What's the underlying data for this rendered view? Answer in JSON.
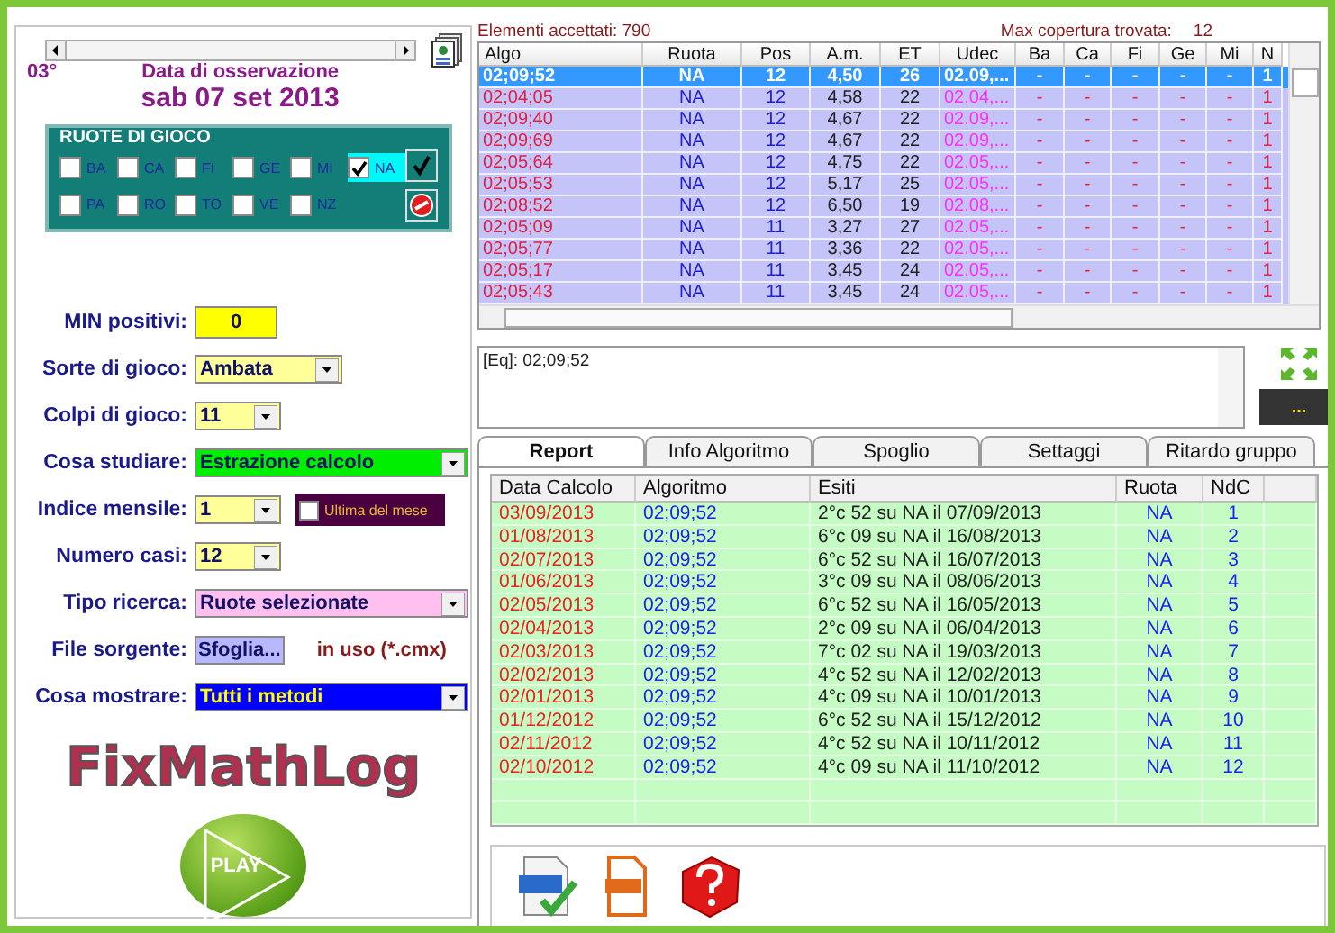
{
  "left": {
    "position": "03°",
    "date_caption": "Data di osservazione",
    "date": "sab 07 set 2013",
    "ruote": {
      "title": "RUOTE DI GIOCO",
      "items": [
        {
          "label": "BA",
          "checked": false
        },
        {
          "label": "CA",
          "checked": false
        },
        {
          "label": "FI",
          "checked": false
        },
        {
          "label": "GE",
          "checked": false
        },
        {
          "label": "MI",
          "checked": false
        },
        {
          "label": "NA",
          "checked": true
        },
        {
          "label": "PA",
          "checked": false
        },
        {
          "label": "RO",
          "checked": false
        },
        {
          "label": "TO",
          "checked": false
        },
        {
          "label": "VE",
          "checked": false
        },
        {
          "label": "NZ",
          "checked": false
        }
      ]
    },
    "fields": [
      {
        "label": "MIN positivi:",
        "kind": "number",
        "value": "0",
        "color": "#ffff00"
      },
      {
        "label": "Sorte di gioco:",
        "kind": "select",
        "value": "Ambata",
        "color": "#ffff99"
      },
      {
        "label": "Colpi di gioco:",
        "kind": "select",
        "value": "11",
        "color": "#ffff99"
      },
      {
        "label": "Cosa studiare:",
        "kind": "select",
        "value": "Estrazione calcolo",
        "color": "#00ee00"
      },
      {
        "label": "Indice mensile:",
        "kind": "select",
        "value": "1",
        "color": "#ffff99",
        "extra": {
          "label": "Ultima del mese",
          "checked": false
        }
      },
      {
        "label": "Numero casi:",
        "kind": "select",
        "value": "12",
        "color": "#ffff99"
      },
      {
        "label": "Tipo ricerca:",
        "kind": "select",
        "value": "Ruote selezionate",
        "color": "#ffc0f0"
      },
      {
        "label": "File sorgente:",
        "kind": "file",
        "value": "Sfoglia...",
        "note": "in uso (*.cmx)",
        "color": "#b8b8ff"
      },
      {
        "label": "Cosa mostrare:",
        "kind": "select",
        "value": "Tutti i metodi",
        "color": "#0000ff"
      }
    ],
    "logo": "FixMathLog",
    "play": "PLAY"
  },
  "right": {
    "accepted": "Elementi accettati: 790",
    "max_label": "Max copertura trovata:",
    "max_value": "12",
    "grid": {
      "columns": [
        "Algo",
        "Ruota",
        "Pos",
        "A.m.",
        "ET",
        "Udec",
        "Ba",
        "Ca",
        "Fi",
        "Ge",
        "Mi",
        "N"
      ],
      "rows": [
        {
          "selected": true,
          "cells": [
            "02;09;52",
            "NA",
            "12",
            "4,50",
            "26",
            "02.09,...",
            "-",
            "-",
            "-",
            "-",
            "-",
            "1"
          ]
        },
        {
          "selected": false,
          "cells": [
            "02;04;05",
            "NA",
            "12",
            "4,58",
            "22",
            "02.04,...",
            "-",
            "-",
            "-",
            "-",
            "-",
            "1"
          ]
        },
        {
          "selected": false,
          "cells": [
            "02;09;40",
            "NA",
            "12",
            "4,67",
            "22",
            "02.09,...",
            "-",
            "-",
            "-",
            "-",
            "-",
            "1"
          ]
        },
        {
          "selected": false,
          "cells": [
            "02;09;69",
            "NA",
            "12",
            "4,67",
            "22",
            "02.09,...",
            "-",
            "-",
            "-",
            "-",
            "-",
            "1"
          ]
        },
        {
          "selected": false,
          "cells": [
            "02;05;64",
            "NA",
            "12",
            "4,75",
            "22",
            "02.05,...",
            "-",
            "-",
            "-",
            "-",
            "-",
            "1"
          ]
        },
        {
          "selected": false,
          "cells": [
            "02;05;53",
            "NA",
            "12",
            "5,17",
            "25",
            "02.05,...",
            "-",
            "-",
            "-",
            "-",
            "-",
            "1"
          ]
        },
        {
          "selected": false,
          "cells": [
            "02;08;52",
            "NA",
            "12",
            "6,50",
            "19",
            "02.08,...",
            "-",
            "-",
            "-",
            "-",
            "-",
            "1"
          ]
        },
        {
          "selected": false,
          "cells": [
            "02;05;09",
            "NA",
            "11",
            "3,27",
            "27",
            "02.05,...",
            "-",
            "-",
            "-",
            "-",
            "-",
            "1"
          ]
        },
        {
          "selected": false,
          "cells": [
            "02;05;77",
            "NA",
            "11",
            "3,36",
            "22",
            "02.05,...",
            "-",
            "-",
            "-",
            "-",
            "-",
            "1"
          ]
        },
        {
          "selected": false,
          "cells": [
            "02;05;17",
            "NA",
            "11",
            "3,45",
            "24",
            "02.05,...",
            "-",
            "-",
            "-",
            "-",
            "-",
            "1"
          ]
        },
        {
          "selected": false,
          "cells": [
            "02;05;43",
            "NA",
            "11",
            "3,45",
            "24",
            "02.05,...",
            "-",
            "-",
            "-",
            "-",
            "-",
            "1"
          ]
        }
      ]
    },
    "equation": "[Eq]: 02;09;52",
    "more_button": "...",
    "tabs": [
      {
        "label": "Report",
        "selected": true
      },
      {
        "label": "Info Algoritmo",
        "selected": false
      },
      {
        "label": "Spoglio",
        "selected": false
      },
      {
        "label": "Settaggi",
        "selected": false
      },
      {
        "label": "Ritardo gruppo",
        "selected": false
      }
    ],
    "report": {
      "columns": [
        "Data Calcolo",
        "Algoritmo",
        "Esiti",
        "Ruota",
        "NdC"
      ],
      "rows": [
        [
          "03/09/2013",
          "02;09;52",
          "2°c 52 su NA il 07/09/2013",
          "NA",
          "1"
        ],
        [
          "01/08/2013",
          "02;09;52",
          "6°c 09 su NA il 16/08/2013",
          "NA",
          "2"
        ],
        [
          "02/07/2013",
          "02;09;52",
          "6°c 52 su NA il 16/07/2013",
          "NA",
          "3"
        ],
        [
          "01/06/2013",
          "02;09;52",
          "3°c 09 su NA il 08/06/2013",
          "NA",
          "4"
        ],
        [
          "02/05/2013",
          "02;09;52",
          "6°c 52 su NA il 16/05/2013",
          "NA",
          "5"
        ],
        [
          "02/04/2013",
          "02;09;52",
          "2°c 09 su NA il 06/04/2013",
          "NA",
          "6"
        ],
        [
          "02/03/2013",
          "02;09;52",
          "7°c 02 su NA il 19/03/2013",
          "NA",
          "7"
        ],
        [
          "02/02/2013",
          "02;09;52",
          "4°c 52 su NA il 12/02/2013",
          "NA",
          "8"
        ],
        [
          "02/01/2013",
          "02;09;52",
          "4°c 09 su NA il 10/01/2013",
          "NA",
          "9"
        ],
        [
          "01/12/2012",
          "02;09;52",
          "6°c 52 su NA il 15/12/2012",
          "NA",
          "10"
        ],
        [
          "02/11/2012",
          "02;09;52",
          "4°c 52 su NA il 10/11/2012",
          "NA",
          "11"
        ],
        [
          "02/10/2012",
          "02;09;52",
          "4°c 09 su NA il 11/10/2012",
          "NA",
          "12"
        ]
      ]
    }
  }
}
